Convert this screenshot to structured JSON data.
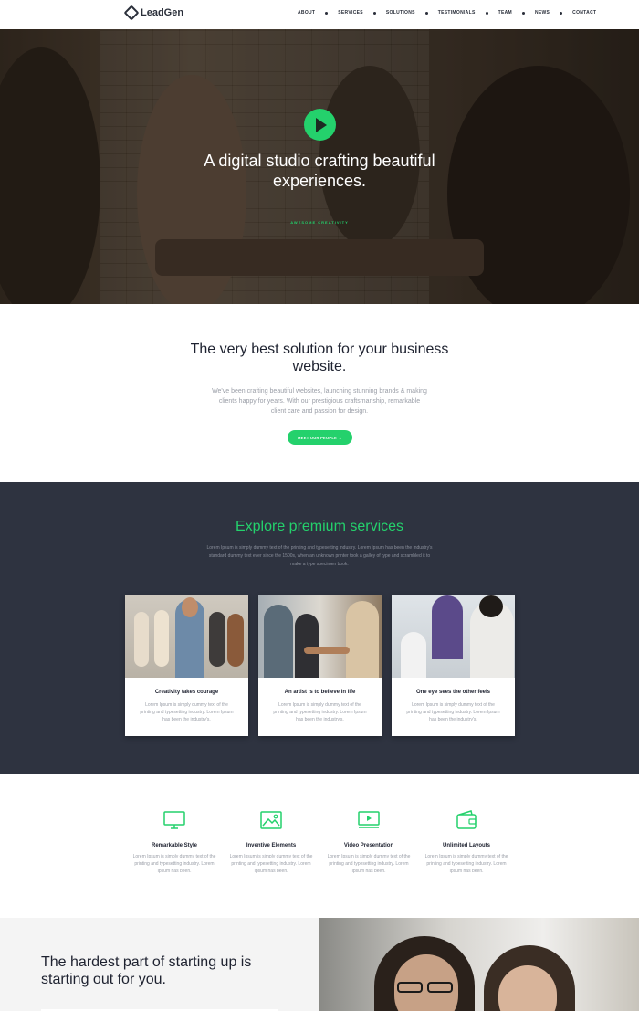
{
  "brand": {
    "name": "LeadGen"
  },
  "nav": {
    "items": [
      "ABOUT",
      "SERVICES",
      "SOLUTIONS",
      "TESTIMONIALS",
      "TEAM",
      "NEWS",
      "CONTACT"
    ]
  },
  "hero": {
    "title": "A digital studio crafting beautiful experiences.",
    "subtitle": "AWESOME CREATIVITY",
    "play_icon": "play-icon",
    "accent": "#24d16c"
  },
  "solution": {
    "title": "The very best solution for your business website.",
    "text": "We've been crafting beautiful websites, launching stunning brands & making clients happy for years. With our prestigious craftsmanship, remarkable client care and passion for design.",
    "button": "MEET OUR PEOPLE →"
  },
  "services": {
    "title": "Explore premium services",
    "text": "Lorem Ipsum is simply dummy text of the printing and typesetting industry. Lorem Ipsum has been the industry's standard dummy text ever since the 1500s, when an unknown printer took a galley of type and scrambled it to make a type specimen book.",
    "cards": [
      {
        "title": "Creativity takes courage",
        "text": "Lorem Ipsum is simply dummy text of the printing and typesetting industry. Lorem Ipsum has been the industry's."
      },
      {
        "title": "An artist is to believe in life",
        "text": "Lorem Ipsum is simply dummy text of the printing and typesetting industry. Lorem Ipsum has been the industry's."
      },
      {
        "title": "One eye sees the other feels",
        "text": "Lorem Ipsum is simply dummy text of the printing and typesetting industry. Lorem Ipsum has been the industry's."
      }
    ]
  },
  "features": {
    "items": [
      {
        "icon": "monitor-icon",
        "title": "Remarkable Style",
        "text": "Lorem Ipsum is simply dummy text of the printing and typesetting industry. Lorem Ipsum has been."
      },
      {
        "icon": "image-icon",
        "title": "Inventive Elements",
        "text": "Lorem Ipsum is simply dummy text of the printing and typesetting industry. Lorem Ipsum has been."
      },
      {
        "icon": "video-icon",
        "title": "Video Presentation",
        "text": "Lorem Ipsum is simply dummy text of the printing and typesetting industry. Lorem Ipsum has been."
      },
      {
        "icon": "wallet-icon",
        "title": "Unlimited Layouts",
        "text": "Lorem Ipsum is simply dummy text of the printing and typesetting industry. Lorem Ipsum has been."
      }
    ]
  },
  "bottom": {
    "title": "The hardest part of starting up is starting out for you."
  }
}
